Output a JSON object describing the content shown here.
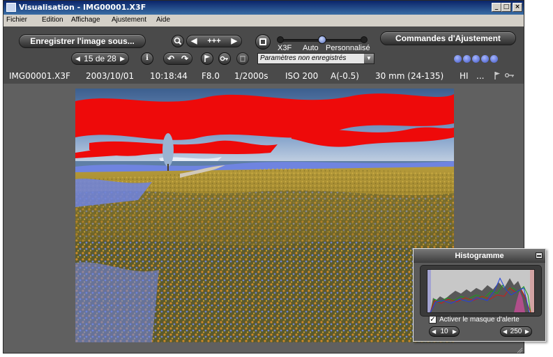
{
  "window": {
    "title": "Visualisation - IMG00001.X3F",
    "controls": [
      "_",
      "□",
      "×"
    ]
  },
  "menu": [
    {
      "label": "Fichier"
    },
    {
      "label": "Edition"
    },
    {
      "label": "Affichage"
    },
    {
      "label": "Ajustement"
    },
    {
      "label": "Aide"
    }
  ],
  "toolbar": {
    "save_label": "Enregistrer l'image sous...",
    "zoom_value": "+++",
    "counter": "15 de 28",
    "mode_labels": [
      "X3F",
      "Auto",
      "Personnalisé"
    ],
    "settings_status": "Paramètres non enregistrés",
    "adjust_label": "Commandes d'Ajustement",
    "icons": [
      "zoom-icon",
      "info-icon",
      "rotate-left-icon",
      "rotate-right-icon",
      "flag-icon",
      "lock-icon",
      "trash-icon"
    ]
  },
  "info": {
    "filename": "IMG00001.X3F",
    "date": "2003/10/01",
    "time": "10:18:44",
    "aperture": "F8.0",
    "shutter": "1/2000s",
    "iso": "ISO 200",
    "exposure": "A(-0.5)",
    "focal": "30 mm (24-135)",
    "quality": "HI",
    "more": "..."
  },
  "histogram": {
    "title": "Histogramme",
    "checkbox_label": "Activer le masque d'alerte",
    "checked": true,
    "low_value": "10",
    "high_value": "250"
  }
}
